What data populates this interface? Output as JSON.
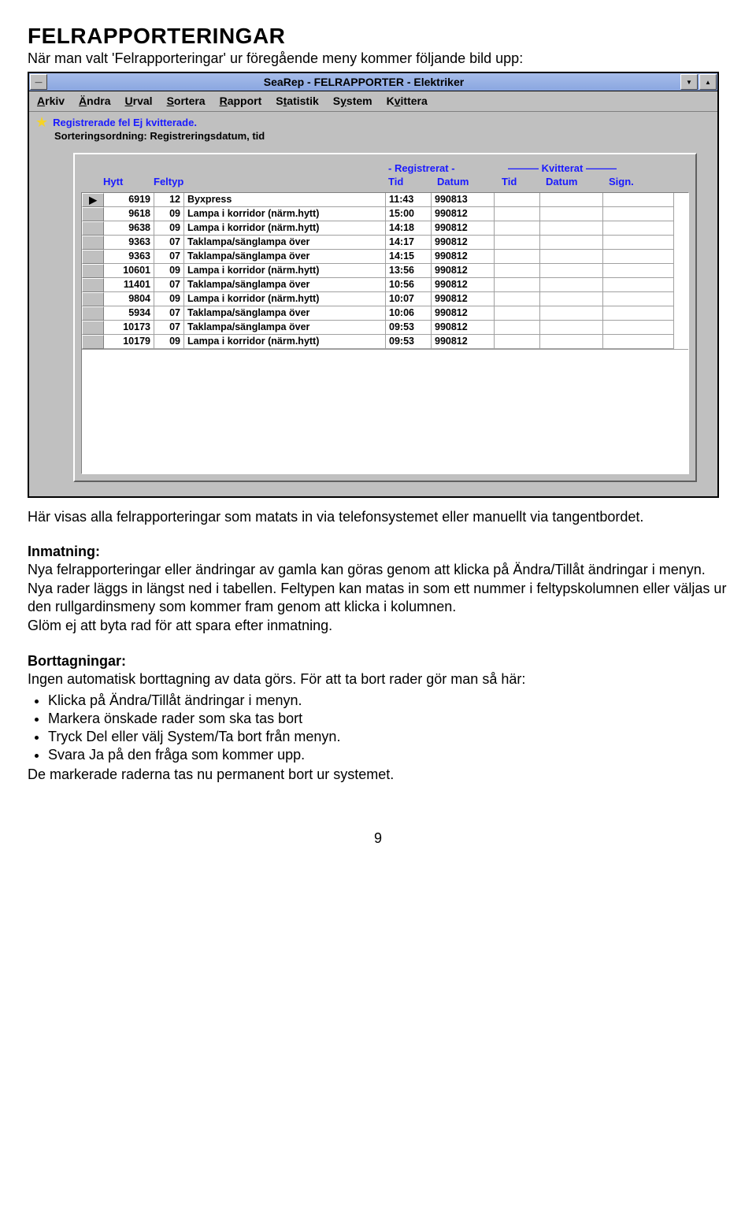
{
  "heading": "FELRAPPORTERINGAR",
  "lead": "När man valt 'Felrapporteringar' ur föregående meny kommer följande bild upp:",
  "after_shot": "Här visas alla felrapporteringar som matats in via telefonsystemet eller manuellt via tangentbordet.",
  "inmatning": {
    "title": "Inmatning:",
    "body": "Nya felrapporteringar eller ändringar av gamla kan göras genom att klicka på Ändra/Tillåt ändringar i menyn. Nya rader läggs in längst ned i tabellen. Feltypen kan matas in som ett nummer i feltypskolumnen eller väljas ur den rullgardinsmeny som kommer fram genom att klicka i kolumnen.",
    "body2": "Glöm ej att byta rad för att spara efter inmatning."
  },
  "borttag": {
    "title": "Borttagningar:",
    "intro": "Ingen automatisk borttagning av data görs. För att ta bort rader gör man så här:",
    "items": [
      "Klicka på Ändra/Tillåt ändringar i menyn.",
      "Markera önskade rader som ska tas bort",
      "Tryck Del eller välj System/Ta bort från menyn.",
      "Svara Ja på den fråga som kommer upp."
    ],
    "closing": "De markerade raderna tas nu permanent bort ur systemet."
  },
  "page_number": "9",
  "window": {
    "title": "SeaRep - FELRAPPORTER - Elektriker",
    "menu": [
      "Arkiv",
      "Ändra",
      "Urval",
      "Sortera",
      "Rapport",
      "Statistik",
      "System",
      "Kvittera"
    ],
    "menu_ul": [
      "A",
      "Ä",
      "U",
      "S",
      "R",
      "t",
      "y",
      "v"
    ],
    "status1": "Registrerade fel  Ej kvitterade.",
    "status2": "Sorteringsordning: Registreringsdatum, tid",
    "group_reg": "- Registrerat -",
    "group_kv": "——— Kvitterat ———",
    "cols": {
      "hytt": "Hytt",
      "feltyp": "Feltyp",
      "tid": "Tid",
      "datum": "Datum",
      "ktid": "Tid",
      "kdatum": "Datum",
      "sign": "Sign."
    },
    "rows": [
      {
        "sel": "▶",
        "hytt": "6919",
        "ft": "12",
        "desc": "Byxpress",
        "tid": "11:43",
        "datum": "990813"
      },
      {
        "sel": "",
        "hytt": "9618",
        "ft": "09",
        "desc": "Lampa i korridor (närm.hytt)",
        "tid": "15:00",
        "datum": "990812"
      },
      {
        "sel": "",
        "hytt": "9638",
        "ft": "09",
        "desc": "Lampa i korridor (närm.hytt)",
        "tid": "14:18",
        "datum": "990812"
      },
      {
        "sel": "",
        "hytt": "9363",
        "ft": "07",
        "desc": "Taklampa/sänglampa över",
        "tid": "14:17",
        "datum": "990812"
      },
      {
        "sel": "",
        "hytt": "9363",
        "ft": "07",
        "desc": "Taklampa/sänglampa över",
        "tid": "14:15",
        "datum": "990812"
      },
      {
        "sel": "",
        "hytt": "10601",
        "ft": "09",
        "desc": "Lampa i korridor (närm.hytt)",
        "tid": "13:56",
        "datum": "990812"
      },
      {
        "sel": "",
        "hytt": "11401",
        "ft": "07",
        "desc": "Taklampa/sänglampa över",
        "tid": "10:56",
        "datum": "990812"
      },
      {
        "sel": "",
        "hytt": "9804",
        "ft": "09",
        "desc": "Lampa i korridor (närm.hytt)",
        "tid": "10:07",
        "datum": "990812"
      },
      {
        "sel": "",
        "hytt": "5934",
        "ft": "07",
        "desc": "Taklampa/sänglampa över",
        "tid": "10:06",
        "datum": "990812"
      },
      {
        "sel": "",
        "hytt": "10173",
        "ft": "07",
        "desc": "Taklampa/sänglampa över",
        "tid": "09:53",
        "datum": "990812"
      },
      {
        "sel": "",
        "hytt": "10179",
        "ft": "09",
        "desc": "Lampa i korridor (närm.hytt)",
        "tid": "09:53",
        "datum": "990812"
      }
    ]
  }
}
